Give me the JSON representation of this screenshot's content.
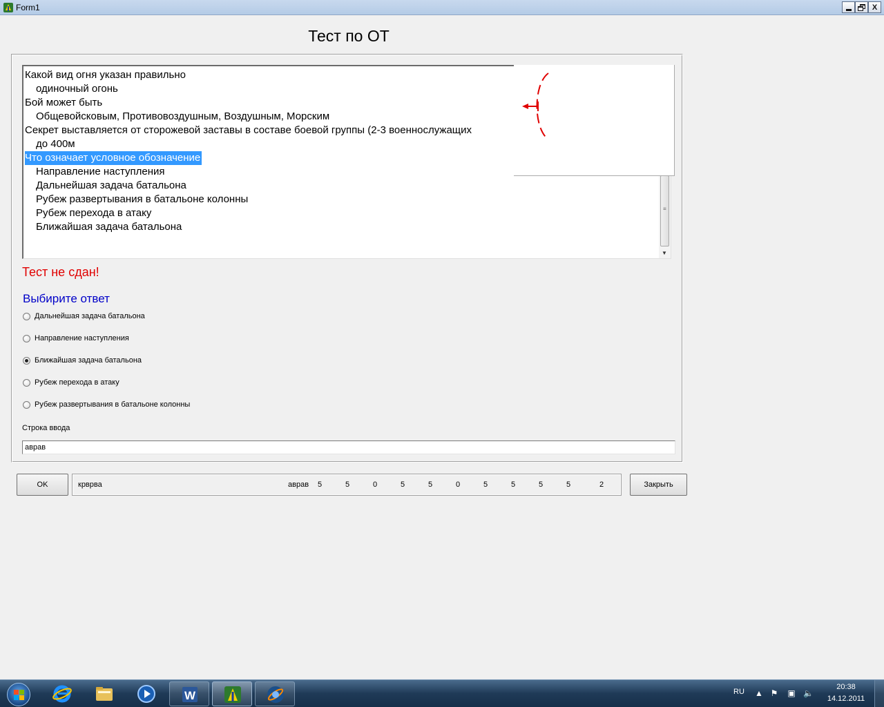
{
  "window": {
    "title": "Form1",
    "minimize_glyph": "",
    "close_glyph": "X"
  },
  "heading": "Тест по ОТ",
  "memo": {
    "lines": [
      {
        "text": "Какой вид огня указан правильно",
        "indent": false,
        "selected": false
      },
      {
        "text": "одиночный огонь",
        "indent": true,
        "selected": false
      },
      {
        "text": "Бой может быть",
        "indent": false,
        "selected": false
      },
      {
        "text": "Общевойсковым, Противовоздушным, Воздушным, Морским",
        "indent": true,
        "selected": false
      },
      {
        "text": "Секрет выставляется от сторожевой заставы в составе боевой группы (2-3 военнослужащих",
        "indent": false,
        "selected": false
      },
      {
        "text": "до 400м",
        "indent": true,
        "selected": false
      },
      {
        "text": "Что означает условное обозначение",
        "indent": false,
        "selected": true
      },
      {
        "text": "Направление наступления",
        "indent": true,
        "selected": false
      },
      {
        "text": "Дальнейшая задача батальона",
        "indent": true,
        "selected": false
      },
      {
        "text": "Рубеж развертывания в батальоне колонны",
        "indent": true,
        "selected": false
      },
      {
        "text": "Рубеж перехода в атаку",
        "indent": true,
        "selected": false
      },
      {
        "text": "Ближайшая задача батальона",
        "indent": true,
        "selected": false
      }
    ]
  },
  "image_panel": {
    "symbol": "tactical-symbol-arc-arrow",
    "color": "#e00000"
  },
  "result_text": "Тест не сдан!",
  "choose_text": "Выбирите ответ",
  "options": [
    {
      "label": "Дальнейшая задача батальона",
      "checked": false
    },
    {
      "label": "Направление наступления",
      "checked": false
    },
    {
      "label": "Ближайшая задача батальона",
      "checked": true
    },
    {
      "label": "Рубеж перехода в атаку",
      "checked": false
    },
    {
      "label": "Рубеж развертывания в батальоне колонны",
      "checked": false
    }
  ],
  "input": {
    "label": "Строка ввода",
    "value": "аврав"
  },
  "ok_label": "OK",
  "close_label": "Закрыть",
  "status": {
    "left_text": "крврва",
    "right_text": "аврав",
    "numbers": [
      "5",
      "5",
      "0",
      "5",
      "5",
      "0",
      "5",
      "5",
      "5",
      "5",
      "2"
    ]
  },
  "taskbar": {
    "apps": [
      {
        "name": "internet-explorer-icon",
        "state": "pinned"
      },
      {
        "name": "explorer-folder-icon",
        "state": "pinned"
      },
      {
        "name": "media-player-icon",
        "state": "pinned"
      },
      {
        "name": "word-icon",
        "state": "open"
      },
      {
        "name": "form-app-icon",
        "state": "active"
      },
      {
        "name": "browser-globe-icon",
        "state": "open"
      }
    ],
    "lang": "RU",
    "time": "20:38",
    "date": "14.12.2011"
  }
}
